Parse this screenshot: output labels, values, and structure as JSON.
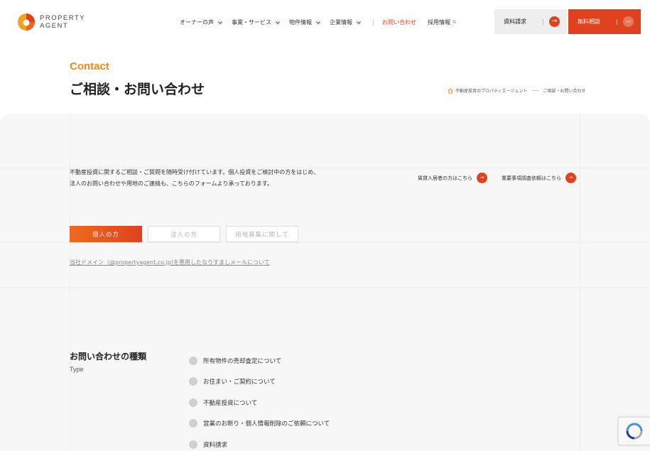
{
  "header": {
    "logo_line1": "PROPERTY",
    "logo_line2": "AGENT",
    "nav": [
      {
        "label": "オーナーの声"
      },
      {
        "label": "事業・サービス"
      },
      {
        "label": "物件情報"
      },
      {
        "label": "企業情報"
      }
    ],
    "contact_label": "お問い合わせ",
    "recruit_label": "採用情報",
    "docs_button": "資料請求",
    "consult_button": "無料相談"
  },
  "page": {
    "eyebrow": "Contact",
    "title": "ご相談・お問い合わせ",
    "breadcrumb": [
      "不動産投資のプロパティエージェント",
      "ご相談・お問い合わせ"
    ]
  },
  "intro": {
    "line1": "不動産投資に関するご相談・ご質問を随時受け付けています。個人投資をご検討中の方をはじめ、",
    "line2": "法人のお問い合わせや用地のご連絡も、こちらのフォームより承っております。"
  },
  "side_links": [
    {
      "label": "賃貸入居者の方はこちら"
    },
    {
      "label": "重要事項調査依頼はこちら"
    }
  ],
  "tabs": [
    {
      "label": "個人の方",
      "active": true
    },
    {
      "label": "法人の方",
      "active": false
    },
    {
      "label": "用地募集に関して",
      "active": false
    }
  ],
  "notice_link": "当社ドメイン（@propertyagent.co.jp)を悪用したなりすましメールについて",
  "inquiry_type": {
    "title": "お問い合わせの種類",
    "subtitle": "Type",
    "options": [
      "所有物件の売却査定について",
      "お住まい・ご契約について",
      "不動産投資について",
      "営業のお断り・個人情報削除のご依頼について",
      "資料請求"
    ]
  },
  "colors": {
    "accent": "#e0421f",
    "eyebrow": "#f08a1a",
    "panel_bg": "#f7f7f7"
  }
}
